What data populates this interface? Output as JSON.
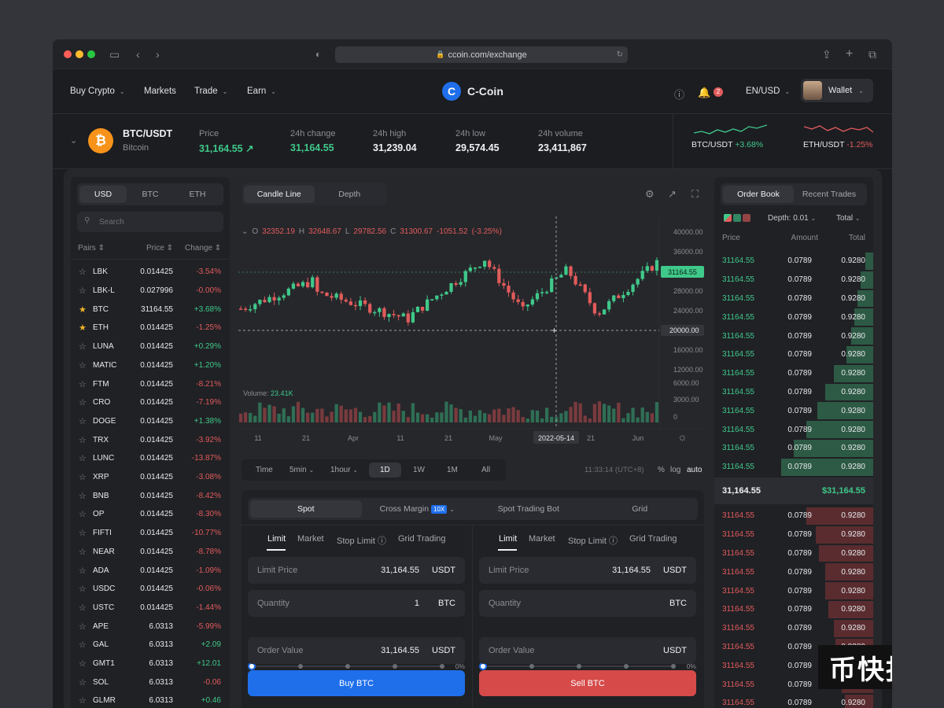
{
  "browser": {
    "url": "ccoin.com/exchange"
  },
  "nav": {
    "items": [
      "Buy Crypto",
      "Markets",
      "Trade",
      "Earn"
    ],
    "brand": "C-Coin",
    "brand_letter": "C",
    "notif_count": "2",
    "lang": "EN/USD",
    "wallet": "Wallet"
  },
  "ticker": {
    "pair": "BTC/USDT",
    "name": "Bitcoin",
    "price_label": "Price",
    "price": "31,164.55",
    "change_label": "24h change",
    "change": "31,164.55",
    "high_label": "24h high",
    "high": "31,239.04",
    "low_label": "24h low",
    "low": "29,574.45",
    "volume_label": "24h volume",
    "volume": "23,411,867",
    "mini": [
      {
        "pair": "BTC/USDT",
        "change": "+3.68%"
      },
      {
        "pair": "ETH/USDT",
        "change": "-1.25%"
      }
    ]
  },
  "markets": {
    "tabs": [
      "USD",
      "BTC",
      "ETH"
    ],
    "search_placeholder": "Search",
    "headers": [
      "Pairs",
      "Price",
      "Change"
    ],
    "rows": [
      {
        "pair": "LBK",
        "price": "0.014425",
        "change": "-3.54%",
        "fav": false
      },
      {
        "pair": "LBK-L",
        "price": "0.027996",
        "change": "-0.00%",
        "fav": false
      },
      {
        "pair": "BTC",
        "price": "31164.55",
        "change": "+3.68%",
        "fav": true
      },
      {
        "pair": "ETH",
        "price": "0.014425",
        "change": "-1.25%",
        "fav": true
      },
      {
        "pair": "LUNA",
        "price": "0.014425",
        "change": "+0.29%",
        "fav": false
      },
      {
        "pair": "MATIC",
        "price": "0.014425",
        "change": "+1.20%",
        "fav": false
      },
      {
        "pair": "FTM",
        "price": "0.014425",
        "change": "-8.21%",
        "fav": false
      },
      {
        "pair": "CRO",
        "price": "0.014425",
        "change": "-7.19%",
        "fav": false
      },
      {
        "pair": "DOGE",
        "price": "0.014425",
        "change": "+1.38%",
        "fav": false
      },
      {
        "pair": "TRX",
        "price": "0.014425",
        "change": "-3.92%",
        "fav": false
      },
      {
        "pair": "LUNC",
        "price": "0.014425",
        "change": "-13.87%",
        "fav": false
      },
      {
        "pair": "XRP",
        "price": "0.014425",
        "change": "-3.08%",
        "fav": false
      },
      {
        "pair": "BNB",
        "price": "0.014425",
        "change": "-8.42%",
        "fav": false
      },
      {
        "pair": "OP",
        "price": "0.014425",
        "change": "-8.30%",
        "fav": false
      },
      {
        "pair": "FIFTI",
        "price": "0.014425",
        "change": "-10.77%",
        "fav": false
      },
      {
        "pair": "NEAR",
        "price": "0.014425",
        "change": "-8.78%",
        "fav": false
      },
      {
        "pair": "ADA",
        "price": "0.014425",
        "change": "-1.09%",
        "fav": false
      },
      {
        "pair": "USDC",
        "price": "0.014425",
        "change": "-0.06%",
        "fav": false
      },
      {
        "pair": "USTC",
        "price": "0.014425",
        "change": "-1.44%",
        "fav": false
      },
      {
        "pair": "APE",
        "price": "6.0313",
        "change": "-5.99%",
        "fav": false
      },
      {
        "pair": "GAL",
        "price": "6.0313",
        "change": "+2.09",
        "fav": false
      },
      {
        "pair": "GMT1",
        "price": "6.0313",
        "change": "+12.01",
        "fav": false
      },
      {
        "pair": "SOL",
        "price": "6.0313",
        "change": "-0.06",
        "fav": false
      },
      {
        "pair": "GLMR",
        "price": "6.0313",
        "change": "+0.46",
        "fav": false
      }
    ]
  },
  "chart": {
    "tabs": [
      "Candle Line",
      "Depth"
    ],
    "ohlc": {
      "o_label": "O",
      "o": "32352.19",
      "h_label": "H",
      "h": "32648.67",
      "l_label": "L",
      "l": "29782.56",
      "c_label": "C",
      "c": "31300.67",
      "chg": "-1051.52",
      "chg_pct": "(-3.25%)"
    },
    "price_ticks": [
      "40000.00",
      "36000.00",
      "32000.00",
      "28000.00",
      "24000.00",
      "20000.00",
      "16000.00",
      "12000.00",
      "6000.00",
      "3000.00",
      "0"
    ],
    "current_price": "31164.55",
    "volume_label": "Volume:",
    "volume": "23.41K",
    "x_ticks": [
      "11",
      "21",
      "Apr",
      "11",
      "21",
      "May",
      "2022-05-14",
      "21",
      "Jun"
    ],
    "timeframes": [
      "Time",
      "5min",
      "1hour",
      "1D",
      "1W",
      "1M",
      "All"
    ],
    "active_tf": "1D",
    "clock": "11:33:14 (UTC+8)",
    "scale_opts": [
      "%",
      "log",
      "auto"
    ]
  },
  "chart_data": {
    "type": "candlestick",
    "y_ticks": [
      40000,
      36000,
      32000,
      28000,
      24000,
      20000,
      16000,
      12000,
      6000,
      3000,
      0
    ],
    "x_ticks": [
      "11",
      "21",
      "Apr",
      "11",
      "21",
      "May",
      "2022-05-14",
      "21",
      "Jun"
    ],
    "current_price": 31164.55
  },
  "trade": {
    "modes": [
      "Spot",
      "Cross Margin",
      "Spot Trading Bot",
      "Grid"
    ],
    "margin_badge": "10X",
    "order_tabs": [
      "Limit",
      "Market",
      "Stop Limit",
      "Grid Trading"
    ],
    "buy": {
      "limit_label": "Limit Price",
      "limit": "31,164.55",
      "limit_unit": "USDT",
      "qty_label": "Quantity",
      "qty": "1",
      "qty_unit": "BTC",
      "pct": "0%",
      "value_label": "Order Value",
      "value": "31,164.55",
      "value_unit": "USDT",
      "button": "Buy BTC"
    },
    "sell": {
      "limit_label": "Limit Price",
      "limit": "31,164.55",
      "limit_unit": "USDT",
      "qty_label": "Quantity",
      "qty": "",
      "qty_unit": "BTC",
      "pct": "0%",
      "value_label": "Order Value",
      "value": "",
      "value_unit": "USDT",
      "button": "Sell BTC"
    }
  },
  "orderbook": {
    "tabs": [
      "Order Book",
      "Recent Trades"
    ],
    "depth_label": "Depth:",
    "depth": "0.01",
    "total_label": "Total",
    "headers": [
      "Price",
      "Amount",
      "Total"
    ],
    "asks": [
      {
        "p": "31164.55",
        "a": "0.0789",
        "t": "0.9280",
        "fill": 0.05
      },
      {
        "p": "31164.55",
        "a": "0.0789",
        "t": "0.9280",
        "fill": 0.08
      },
      {
        "p": "31164.55",
        "a": "0.0789",
        "t": "0.9280",
        "fill": 0.1
      },
      {
        "p": "31164.55",
        "a": "0.0789",
        "t": "0.9280",
        "fill": 0.12
      },
      {
        "p": "31164.55",
        "a": "0.0789",
        "t": "0.9280",
        "fill": 0.14
      },
      {
        "p": "31164.55",
        "a": "0.0789",
        "t": "0.9280",
        "fill": 0.17
      },
      {
        "p": "31164.55",
        "a": "0.0789",
        "t": "0.9280",
        "fill": 0.25
      },
      {
        "p": "31164.55",
        "a": "0.0789",
        "t": "0.9280",
        "fill": 0.3
      },
      {
        "p": "31164.55",
        "a": "0.0789",
        "t": "0.9280",
        "fill": 0.35
      },
      {
        "p": "31164.55",
        "a": "0.0789",
        "t": "0.9280",
        "fill": 0.42
      },
      {
        "p": "31164.55",
        "a": "0.0789",
        "t": "0.9280",
        "fill": 0.5
      },
      {
        "p": "31164.55",
        "a": "0.0789",
        "t": "0.9280",
        "fill": 0.58
      }
    ],
    "mid": "31,164.55",
    "mid_usd": "$31,164.55",
    "bids": [
      {
        "p": "31164.55",
        "a": "0.0789",
        "t": "0.9280",
        "fill": 0.42
      },
      {
        "p": "31164.55",
        "a": "0.0789",
        "t": "0.9280",
        "fill": 0.36
      },
      {
        "p": "31164.55",
        "a": "0.0789",
        "t": "0.9280",
        "fill": 0.34
      },
      {
        "p": "31164.55",
        "a": "0.0789",
        "t": "0.9280",
        "fill": 0.3
      },
      {
        "p": "31164.55",
        "a": "0.0789",
        "t": "0.9280",
        "fill": 0.3
      },
      {
        "p": "31164.55",
        "a": "0.0789",
        "t": "0.9280",
        "fill": 0.28
      },
      {
        "p": "31164.55",
        "a": "0.0789",
        "t": "0.9280",
        "fill": 0.25
      },
      {
        "p": "31164.55",
        "a": "0.0789",
        "t": "0.9280",
        "fill": 0.24
      },
      {
        "p": "31164.55",
        "a": "0.0789",
        "t": "0.9280",
        "fill": 0.2
      },
      {
        "p": "31164.55",
        "a": "0.0789",
        "t": "0.9280",
        "fill": 0.2
      },
      {
        "p": "31164.55",
        "a": "0.0789",
        "t": "0.9280",
        "fill": 0.18
      }
    ]
  },
  "watermark": "币快报",
  "colors": {
    "green": "#3fc98a",
    "red": "#e25b5b",
    "accent": "#1f6feb",
    "bg": "#1c1d21"
  }
}
